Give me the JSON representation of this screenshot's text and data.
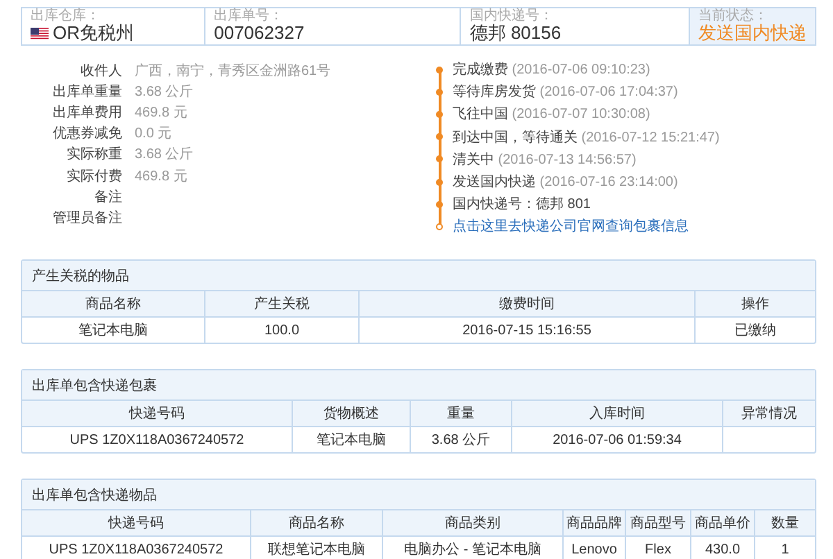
{
  "summary": [
    {
      "label": "出库仓库：",
      "value": "OR免税州",
      "kind": "flag"
    },
    {
      "label": "出库单号：",
      "value": "007062327",
      "kind": "plain"
    },
    {
      "label": "国内快递号：",
      "value": "德邦 80156",
      "kind": "plain"
    },
    {
      "label": "当前状态：",
      "value": "发送国内快递",
      "kind": "status"
    }
  ],
  "details": [
    {
      "label": "收件人",
      "value": "广西，南宁，青秀区金洲路61号"
    },
    {
      "label": "出库单重量",
      "value": "3.68 公斤"
    },
    {
      "label": "出库单费用",
      "value": "469.8 元"
    },
    {
      "label": "优惠券减免",
      "value": "0.0 元"
    },
    {
      "label": "实际称重",
      "value": "3.68 公斤"
    },
    {
      "label": "实际付费",
      "value": "469.8 元"
    },
    {
      "label": "备注"
    },
    {
      "label": "管理员备注"
    }
  ],
  "timeline": [
    {
      "kind": "event",
      "text": "完成缴费",
      "time": "(2016-07-06 09:10:23)"
    },
    {
      "kind": "event",
      "text": "等待库房发货",
      "time": "(2016-07-06 17:04:37)"
    },
    {
      "kind": "event",
      "text": "飞往中国",
      "time": "(2016-07-07 10:30:08)"
    },
    {
      "kind": "event",
      "text": "到达中国，等待通关",
      "time": "(2016-07-12 15:21:47)"
    },
    {
      "kind": "event",
      "text": "清关中",
      "time": "(2016-07-13 14:56:57)"
    },
    {
      "kind": "event",
      "text": "发送国内快递",
      "time": "(2016-07-16 23:14:00)"
    },
    {
      "kind": "event",
      "text": "国内快递号：德邦 801"
    },
    {
      "kind": "link",
      "text": "点击这里去快递公司官网查询包裹信息"
    }
  ],
  "tables": [
    {
      "title": "产生关税的物品",
      "columns": [
        "商品名称",
        "产生关税",
        "缴费时间",
        "操作"
      ],
      "rows": [
        [
          "笔记本电脑",
          "100.0",
          "2016-07-15 15:16:55",
          "已缴纳"
        ]
      ]
    },
    {
      "title": "出库单包含快递包裹",
      "columns": [
        "快递号码",
        "货物概述",
        "重量",
        "入库时间",
        "异常情况"
      ],
      "rows": [
        [
          "UPS 1Z0X118A0367240572",
          "笔记本电脑",
          "3.68 公斤",
          "2016-07-06 01:59:34",
          null
        ]
      ]
    },
    {
      "title": "出库单包含快递物品",
      "columns": [
        "快递号码",
        "商品名称",
        "商品类别",
        "商品品牌",
        "商品型号",
        "商品单价",
        "数量"
      ],
      "rows": [
        [
          "UPS 1Z0X118A0367240572",
          "联想笔记本电脑",
          "电脑办公 - 笔记本电脑",
          "Lenovo",
          "Flex",
          "430.0",
          "1"
        ]
      ]
    }
  ]
}
